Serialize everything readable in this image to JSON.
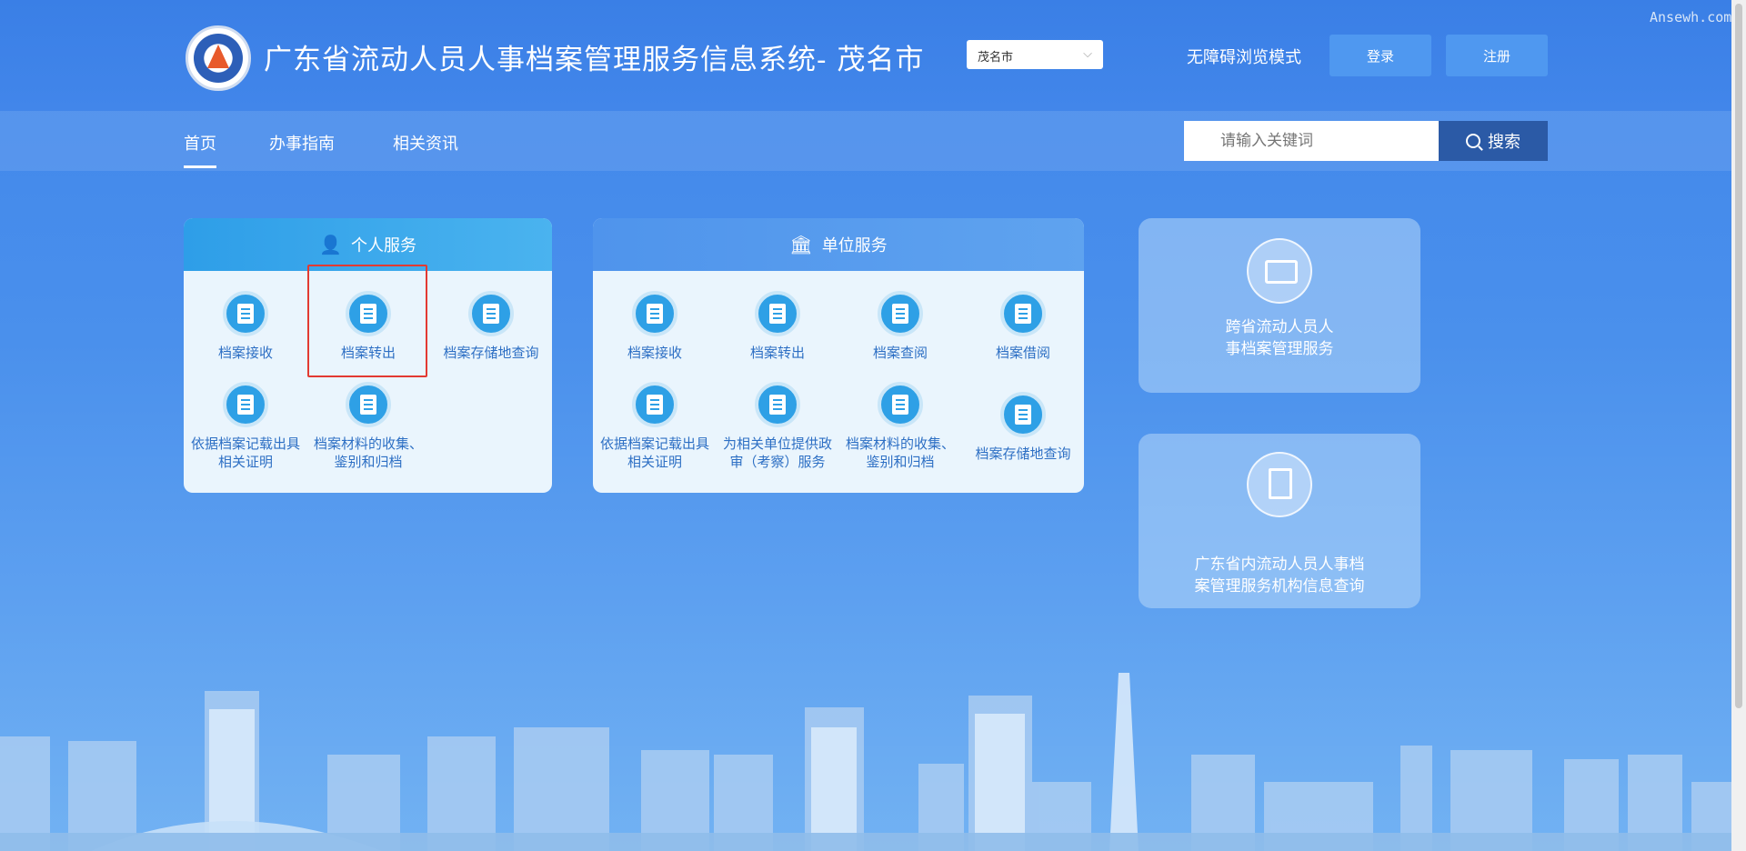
{
  "header": {
    "title": "广东省流动人员人事档案管理服务信息系统- 茂名市",
    "city_select": "茂名市",
    "accessibility": "无障碍浏览模式",
    "login": "登录",
    "register": "注册"
  },
  "watermark": "Ansewh.com",
  "nav": {
    "items": [
      "首页",
      "办事指南",
      "相关资讯"
    ],
    "active": "首页"
  },
  "search": {
    "placeholder": "请输入关键词",
    "button": "搜索"
  },
  "personal": {
    "title": "个人服务",
    "items": [
      {
        "label": "档案接收",
        "icon": "document-in-icon"
      },
      {
        "label": "档案转出",
        "icon": "document-out-icon",
        "highlighted": true
      },
      {
        "label": "档案存储地查询",
        "icon": "document-search-icon"
      },
      {
        "label_lines": [
          "依据档案记载出具",
          "相关证明"
        ],
        "icon": "certificate-icon"
      },
      {
        "label_lines": [
          "档案材料的收集、",
          "鉴别和归档"
        ],
        "icon": "archive-icon"
      }
    ]
  },
  "unit": {
    "title": "单位服务",
    "items": [
      {
        "label": "档案接收",
        "icon": "document-in-icon"
      },
      {
        "label": "档案转出",
        "icon": "document-out-icon"
      },
      {
        "label": "档案查阅",
        "icon": "book-icon"
      },
      {
        "label": "档案借阅",
        "icon": "document-borrow-icon"
      },
      {
        "label_lines": [
          "依据档案记载出具",
          "相关证明"
        ],
        "icon": "certificate-icon"
      },
      {
        "label_lines": [
          "为相关单位提供政",
          "审（考察）服务"
        ],
        "icon": "review-icon"
      },
      {
        "label_lines": [
          "档案材料的收集、",
          "鉴别和归档"
        ],
        "icon": "archive-icon"
      },
      {
        "label": "档案存储地查询",
        "icon": "document-search-icon"
      }
    ]
  },
  "cards": [
    {
      "lines": [
        "跨省流动人员人",
        "事档案管理服务"
      ],
      "icon": "id-card-icon"
    },
    {
      "lines": [
        "广东省内流动人员人事档",
        "案管理服务机构信息查询"
      ],
      "icon": "building-search-icon"
    }
  ],
  "colors": {
    "background": "#4a90ec",
    "highlight": "#e23a32",
    "search_button": "#2b5aa6"
  }
}
